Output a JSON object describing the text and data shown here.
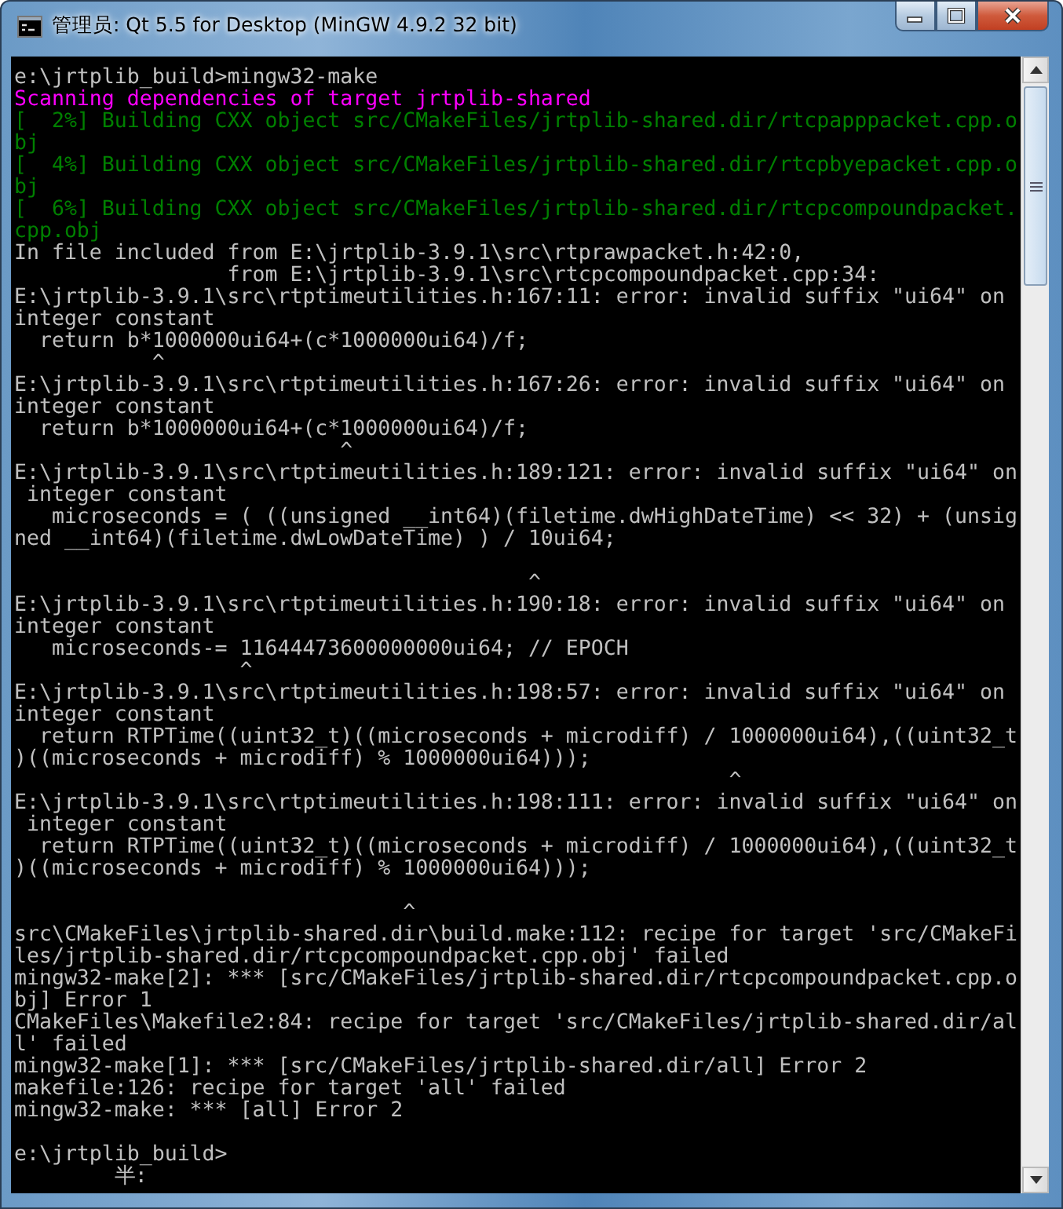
{
  "window": {
    "title": "管理员: Qt 5.5 for Desktop (MinGW 4.9.2 32 bit)"
  },
  "console": {
    "lines": [
      {
        "kind": "text",
        "color": "#c0c0c0",
        "text": "e:\\jrtplib_build>mingw32-make"
      },
      {
        "kind": "text",
        "color": "#ff00ff",
        "text": "Scanning dependencies of target jrtplib-shared"
      },
      {
        "kind": "text",
        "color": "#008000",
        "text": "[  2%] Building CXX object src/CMakeFiles/jrtplib-shared.dir/rtcpapppacket.cpp.o"
      },
      {
        "kind": "text",
        "color": "#008000",
        "text": "bj"
      },
      {
        "kind": "text",
        "color": "#008000",
        "text": "[  4%] Building CXX object src/CMakeFiles/jrtplib-shared.dir/rtcpbyepacket.cpp.o"
      },
      {
        "kind": "text",
        "color": "#008000",
        "text": "bj"
      },
      {
        "kind": "text",
        "color": "#008000",
        "text": "[  6%] Building CXX object src/CMakeFiles/jrtplib-shared.dir/rtcpcompoundpacket."
      },
      {
        "kind": "text",
        "color": "#008000",
        "text": "cpp.obj"
      },
      {
        "kind": "text",
        "color": "#c0c0c0",
        "text": "In file included from E:\\jrtplib-3.9.1\\src\\rtprawpacket.h:42:0,"
      },
      {
        "kind": "text",
        "color": "#c0c0c0",
        "text": "                 from E:\\jrtplib-3.9.1\\src\\rtcpcompoundpacket.cpp:34:"
      },
      {
        "kind": "text",
        "color": "#c0c0c0",
        "text": "E:\\jrtplib-3.9.1\\src\\rtptimeutilities.h:167:11: error: invalid suffix \"ui64\" on"
      },
      {
        "kind": "text",
        "color": "#c0c0c0",
        "text": "integer constant"
      },
      {
        "kind": "text",
        "color": "#c0c0c0",
        "text": "  return b*1000000ui64+(c*1000000ui64)/f;"
      },
      {
        "kind": "text",
        "color": "#c0c0c0",
        "text": "           ^"
      },
      {
        "kind": "text",
        "color": "#c0c0c0",
        "text": "E:\\jrtplib-3.9.1\\src\\rtptimeutilities.h:167:26: error: invalid suffix \"ui64\" on"
      },
      {
        "kind": "text",
        "color": "#c0c0c0",
        "text": "integer constant"
      },
      {
        "kind": "text",
        "color": "#c0c0c0",
        "text": "  return b*1000000ui64+(c*1000000ui64)/f;"
      },
      {
        "kind": "text",
        "color": "#c0c0c0",
        "text": "                          ^"
      },
      {
        "kind": "text",
        "color": "#c0c0c0",
        "text": "E:\\jrtplib-3.9.1\\src\\rtptimeutilities.h:189:121: error: invalid suffix \"ui64\" on"
      },
      {
        "kind": "text",
        "color": "#c0c0c0",
        "text": " integer constant"
      },
      {
        "kind": "text",
        "color": "#c0c0c0",
        "text": "   microseconds = ( ((unsigned __int64)(filetime.dwHighDateTime) << 32) + (unsig"
      },
      {
        "kind": "text",
        "color": "#c0c0c0",
        "text": "ned __int64)(filetime.dwLowDateTime) ) / 10ui64;"
      },
      {
        "kind": "blank"
      },
      {
        "kind": "text",
        "color": "#c0c0c0",
        "text": "                                         ^"
      },
      {
        "kind": "text",
        "color": "#c0c0c0",
        "text": "E:\\jrtplib-3.9.1\\src\\rtptimeutilities.h:190:18: error: invalid suffix \"ui64\" on"
      },
      {
        "kind": "text",
        "color": "#c0c0c0",
        "text": "integer constant"
      },
      {
        "kind": "text",
        "color": "#c0c0c0",
        "text": "   microseconds-= 11644473600000000ui64; // EPOCH"
      },
      {
        "kind": "text",
        "color": "#c0c0c0",
        "text": "                  ^"
      },
      {
        "kind": "text",
        "color": "#c0c0c0",
        "text": "E:\\jrtplib-3.9.1\\src\\rtptimeutilities.h:198:57: error: invalid suffix \"ui64\" on"
      },
      {
        "kind": "text",
        "color": "#c0c0c0",
        "text": "integer constant"
      },
      {
        "kind": "text",
        "color": "#c0c0c0",
        "text": "  return RTPTime((uint32_t)((microseconds + microdiff) / 1000000ui64),((uint32_t"
      },
      {
        "kind": "text",
        "color": "#c0c0c0",
        "text": ")((microseconds + microdiff) % 1000000ui64)));"
      },
      {
        "kind": "text",
        "color": "#c0c0c0",
        "text": "                                                         ^"
      },
      {
        "kind": "text",
        "color": "#c0c0c0",
        "text": "E:\\jrtplib-3.9.1\\src\\rtptimeutilities.h:198:111: error: invalid suffix \"ui64\" on"
      },
      {
        "kind": "text",
        "color": "#c0c0c0",
        "text": " integer constant"
      },
      {
        "kind": "text",
        "color": "#c0c0c0",
        "text": "  return RTPTime((uint32_t)((microseconds + microdiff) / 1000000ui64),((uint32_t"
      },
      {
        "kind": "text",
        "color": "#c0c0c0",
        "text": ")((microseconds + microdiff) % 1000000ui64)));"
      },
      {
        "kind": "blank"
      },
      {
        "kind": "text",
        "color": "#c0c0c0",
        "text": "                               ^"
      },
      {
        "kind": "text",
        "color": "#c0c0c0",
        "text": "src\\CMakeFiles\\jrtplib-shared.dir\\build.make:112: recipe for target 'src/CMakeFi"
      },
      {
        "kind": "text",
        "color": "#c0c0c0",
        "text": "les/jrtplib-shared.dir/rtcpcompoundpacket.cpp.obj' failed"
      },
      {
        "kind": "text",
        "color": "#c0c0c0",
        "text": "mingw32-make[2]: *** [src/CMakeFiles/jrtplib-shared.dir/rtcpcompoundpacket.cpp.o"
      },
      {
        "kind": "text",
        "color": "#c0c0c0",
        "text": "bj] Error 1"
      },
      {
        "kind": "text",
        "color": "#c0c0c0",
        "text": "CMakeFiles\\Makefile2:84: recipe for target 'src/CMakeFiles/jrtplib-shared.dir/al"
      },
      {
        "kind": "text",
        "color": "#c0c0c0",
        "text": "l' failed"
      },
      {
        "kind": "text",
        "color": "#c0c0c0",
        "text": "mingw32-make[1]: *** [src/CMakeFiles/jrtplib-shared.dir/all] Error 2"
      },
      {
        "kind": "text",
        "color": "#c0c0c0",
        "text": "makefile:126: recipe for target 'all' failed"
      },
      {
        "kind": "text",
        "color": "#c0c0c0",
        "text": "mingw32-make: *** [all] Error 2"
      },
      {
        "kind": "blank"
      },
      {
        "kind": "text",
        "color": "#c0c0c0",
        "text": "e:\\jrtplib_build>"
      },
      {
        "kind": "text",
        "color": "#c0c0c0",
        "text": "        半:"
      }
    ]
  }
}
